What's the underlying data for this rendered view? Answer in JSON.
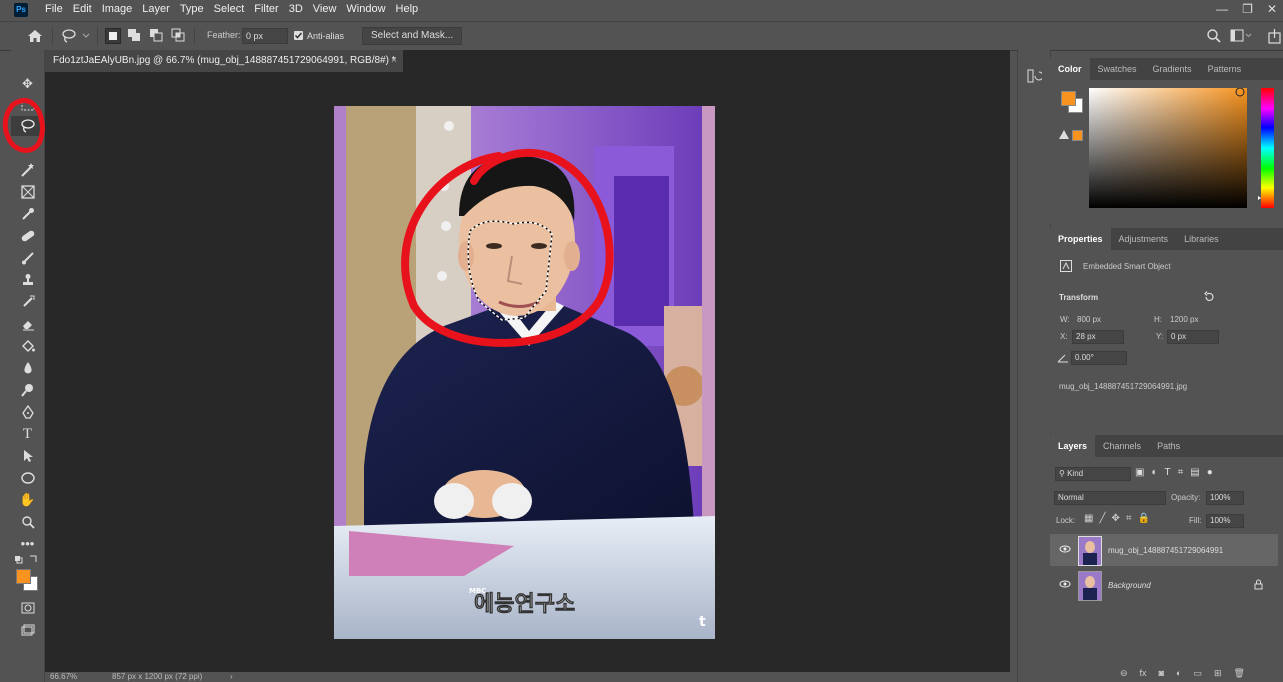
{
  "app": {
    "logo": "Ps"
  },
  "menu": [
    "File",
    "Edit",
    "Image",
    "Layer",
    "Type",
    "Select",
    "Filter",
    "3D",
    "View",
    "Window",
    "Help"
  ],
  "options": {
    "feather_label": "Feather:",
    "feather_value": "0 px",
    "antialias_label": "Anti-alias",
    "select_mask_label": "Select and Mask..."
  },
  "document": {
    "tab_title": "Fdo1ztJaEAlyUBn.jpg @ 66.7% (mug_obj_148887451729064991, RGB/8#) *",
    "close_glyph": "×",
    "caption_small": "MBC",
    "caption": "에능연구소",
    "corner_glyph": "t"
  },
  "status": {
    "zoom": "66.67%",
    "doc_size": "857 px x 1200 px (72 ppi)",
    "arrow": "›"
  },
  "color_panel": {
    "tabs": [
      "Color",
      "Swatches",
      "Gradients",
      "Patterns"
    ],
    "fg_color": "#f7931e",
    "bg_color": "#ffffff"
  },
  "properties": {
    "tabs": [
      "Properties",
      "Adjustments",
      "Libraries"
    ],
    "type": "Embedded Smart Object",
    "transform_label": "Transform",
    "w_label": "W:",
    "w": "800 px",
    "h_label": "H:",
    "h": "1200 px",
    "x_label": "X:",
    "x": "28 px",
    "y_label": "Y:",
    "y": "0 px",
    "angle": "0.00°",
    "filename": "mug_obj_148887451729064991.jpg"
  },
  "layers": {
    "tabs": [
      "Layers",
      "Channels",
      "Paths"
    ],
    "kind": "Kind",
    "blend": "Normal",
    "opacity_label": "Opacity:",
    "opacity": "100%",
    "lock_label": "Lock:",
    "fill_label": "Fill:",
    "fill": "100%",
    "items": [
      {
        "name": "mug_obj_148887451729064991"
      },
      {
        "name": "Background"
      }
    ]
  },
  "annotation_color": "#e8121c"
}
